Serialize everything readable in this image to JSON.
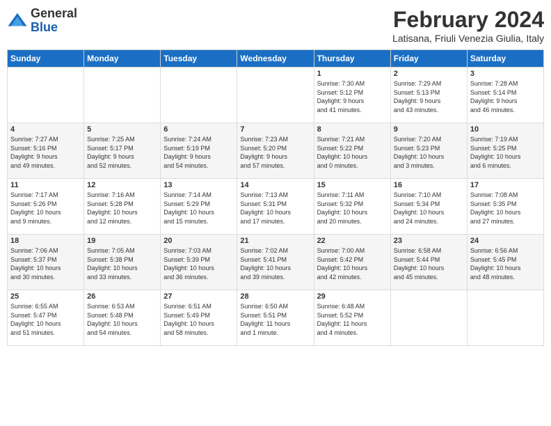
{
  "logo": {
    "text_general": "General",
    "text_blue": "Blue"
  },
  "header": {
    "title": "February 2024",
    "subtitle": "Latisana, Friuli Venezia Giulia, Italy"
  },
  "days_of_week": [
    "Sunday",
    "Monday",
    "Tuesday",
    "Wednesday",
    "Thursday",
    "Friday",
    "Saturday"
  ],
  "weeks": [
    {
      "days": [
        {
          "num": "",
          "info": ""
        },
        {
          "num": "",
          "info": ""
        },
        {
          "num": "",
          "info": ""
        },
        {
          "num": "",
          "info": ""
        },
        {
          "num": "1",
          "info": "Sunrise: 7:30 AM\nSunset: 5:12 PM\nDaylight: 9 hours\nand 41 minutes."
        },
        {
          "num": "2",
          "info": "Sunrise: 7:29 AM\nSunset: 5:13 PM\nDaylight: 9 hours\nand 43 minutes."
        },
        {
          "num": "3",
          "info": "Sunrise: 7:28 AM\nSunset: 5:14 PM\nDaylight: 9 hours\nand 46 minutes."
        }
      ]
    },
    {
      "days": [
        {
          "num": "4",
          "info": "Sunrise: 7:27 AM\nSunset: 5:16 PM\nDaylight: 9 hours\nand 49 minutes."
        },
        {
          "num": "5",
          "info": "Sunrise: 7:25 AM\nSunset: 5:17 PM\nDaylight: 9 hours\nand 52 minutes."
        },
        {
          "num": "6",
          "info": "Sunrise: 7:24 AM\nSunset: 5:19 PM\nDaylight: 9 hours\nand 54 minutes."
        },
        {
          "num": "7",
          "info": "Sunrise: 7:23 AM\nSunset: 5:20 PM\nDaylight: 9 hours\nand 57 minutes."
        },
        {
          "num": "8",
          "info": "Sunrise: 7:21 AM\nSunset: 5:22 PM\nDaylight: 10 hours\nand 0 minutes."
        },
        {
          "num": "9",
          "info": "Sunrise: 7:20 AM\nSunset: 5:23 PM\nDaylight: 10 hours\nand 3 minutes."
        },
        {
          "num": "10",
          "info": "Sunrise: 7:19 AM\nSunset: 5:25 PM\nDaylight: 10 hours\nand 6 minutes."
        }
      ]
    },
    {
      "days": [
        {
          "num": "11",
          "info": "Sunrise: 7:17 AM\nSunset: 5:26 PM\nDaylight: 10 hours\nand 9 minutes."
        },
        {
          "num": "12",
          "info": "Sunrise: 7:16 AM\nSunset: 5:28 PM\nDaylight: 10 hours\nand 12 minutes."
        },
        {
          "num": "13",
          "info": "Sunrise: 7:14 AM\nSunset: 5:29 PM\nDaylight: 10 hours\nand 15 minutes."
        },
        {
          "num": "14",
          "info": "Sunrise: 7:13 AM\nSunset: 5:31 PM\nDaylight: 10 hours\nand 17 minutes."
        },
        {
          "num": "15",
          "info": "Sunrise: 7:11 AM\nSunset: 5:32 PM\nDaylight: 10 hours\nand 20 minutes."
        },
        {
          "num": "16",
          "info": "Sunrise: 7:10 AM\nSunset: 5:34 PM\nDaylight: 10 hours\nand 24 minutes."
        },
        {
          "num": "17",
          "info": "Sunrise: 7:08 AM\nSunset: 5:35 PM\nDaylight: 10 hours\nand 27 minutes."
        }
      ]
    },
    {
      "days": [
        {
          "num": "18",
          "info": "Sunrise: 7:06 AM\nSunset: 5:37 PM\nDaylight: 10 hours\nand 30 minutes."
        },
        {
          "num": "19",
          "info": "Sunrise: 7:05 AM\nSunset: 5:38 PM\nDaylight: 10 hours\nand 33 minutes."
        },
        {
          "num": "20",
          "info": "Sunrise: 7:03 AM\nSunset: 5:39 PM\nDaylight: 10 hours\nand 36 minutes."
        },
        {
          "num": "21",
          "info": "Sunrise: 7:02 AM\nSunset: 5:41 PM\nDaylight: 10 hours\nand 39 minutes."
        },
        {
          "num": "22",
          "info": "Sunrise: 7:00 AM\nSunset: 5:42 PM\nDaylight: 10 hours\nand 42 minutes."
        },
        {
          "num": "23",
          "info": "Sunrise: 6:58 AM\nSunset: 5:44 PM\nDaylight: 10 hours\nand 45 minutes."
        },
        {
          "num": "24",
          "info": "Sunrise: 6:56 AM\nSunset: 5:45 PM\nDaylight: 10 hours\nand 48 minutes."
        }
      ]
    },
    {
      "days": [
        {
          "num": "25",
          "info": "Sunrise: 6:55 AM\nSunset: 5:47 PM\nDaylight: 10 hours\nand 51 minutes."
        },
        {
          "num": "26",
          "info": "Sunrise: 6:53 AM\nSunset: 5:48 PM\nDaylight: 10 hours\nand 54 minutes."
        },
        {
          "num": "27",
          "info": "Sunrise: 6:51 AM\nSunset: 5:49 PM\nDaylight: 10 hours\nand 58 minutes."
        },
        {
          "num": "28",
          "info": "Sunrise: 6:50 AM\nSunset: 5:51 PM\nDaylight: 11 hours\nand 1 minute."
        },
        {
          "num": "29",
          "info": "Sunrise: 6:48 AM\nSunset: 5:52 PM\nDaylight: 11 hours\nand 4 minutes."
        },
        {
          "num": "",
          "info": ""
        },
        {
          "num": "",
          "info": ""
        }
      ]
    }
  ]
}
